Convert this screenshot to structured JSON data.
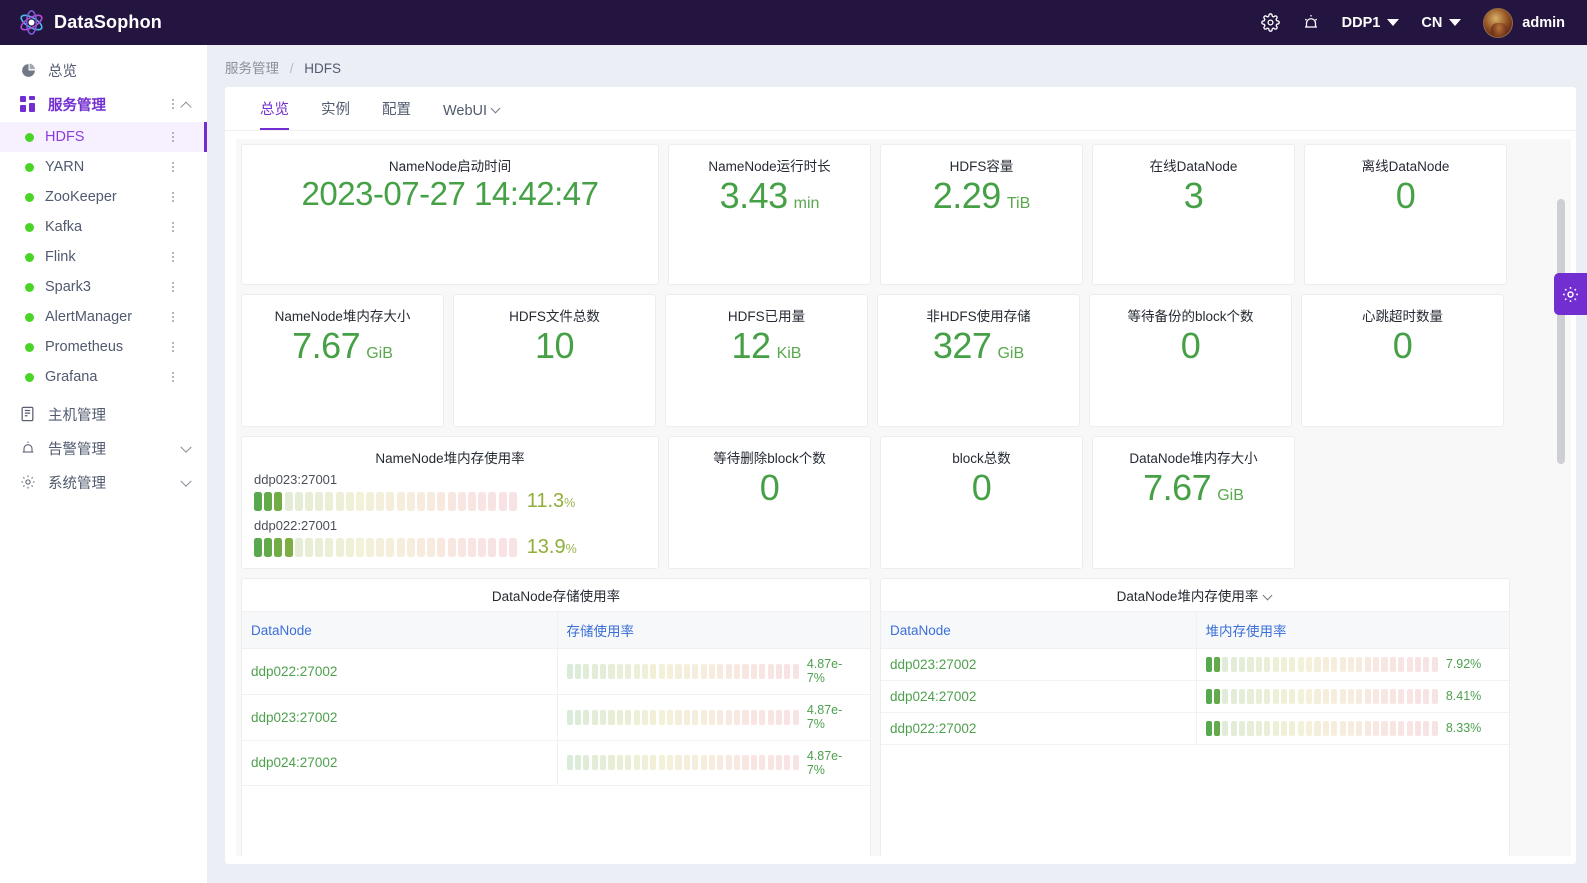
{
  "header": {
    "brand": "DataSophon",
    "logo_icon": "atom-icon",
    "settings_icon": "gear-icon",
    "alarm_icon": "alarm-bell-icon",
    "cluster": "DDP1",
    "language": "CN",
    "user": "admin",
    "avatar_icon": "user-avatar"
  },
  "sidebar": {
    "items": [
      {
        "label": "总览",
        "icon": "dashboard-icon",
        "type": "link"
      },
      {
        "label": "服务管理",
        "icon": "grid-apps-icon",
        "type": "group",
        "expanded": true,
        "active": true
      }
    ],
    "services": [
      {
        "label": "HDFS",
        "status": "running",
        "selected": true
      },
      {
        "label": "YARN",
        "status": "running",
        "selected": false
      },
      {
        "label": "ZooKeeper",
        "status": "running",
        "selected": false
      },
      {
        "label": "Kafka",
        "status": "running",
        "selected": false
      },
      {
        "label": "Flink",
        "status": "running",
        "selected": false
      },
      {
        "label": "Spark3",
        "status": "running",
        "selected": false
      },
      {
        "label": "AlertManager",
        "status": "running",
        "selected": false
      },
      {
        "label": "Prometheus",
        "status": "running",
        "selected": false
      },
      {
        "label": "Grafana",
        "status": "running",
        "selected": false
      }
    ],
    "bottom_items": [
      {
        "label": "主机管理",
        "icon": "server-icon",
        "collapsible": false
      },
      {
        "label": "告警管理",
        "icon": "alarm-bell-icon",
        "collapsible": true
      },
      {
        "label": "系统管理",
        "icon": "gear-icon",
        "collapsible": true
      }
    ]
  },
  "breadcrumb": {
    "parent": "服务管理",
    "separator": "/",
    "current": "HDFS"
  },
  "tabs": [
    {
      "label": "总览",
      "active": true,
      "has_chevron": false
    },
    {
      "label": "实例",
      "active": false,
      "has_chevron": false
    },
    {
      "label": "配置",
      "active": false,
      "has_chevron": false
    },
    {
      "label": "WebUI",
      "active": false,
      "has_chevron": true
    }
  ],
  "metrics_row1": [
    {
      "title": "NameNode启动时间",
      "value": "2023-07-27 14:42:47",
      "unit": "",
      "wide": true
    },
    {
      "title": "NameNode运行时长",
      "value": "3.43",
      "unit": "min"
    },
    {
      "title": "HDFS容量",
      "value": "2.29",
      "unit": "TiB"
    },
    {
      "title": "在线DataNode",
      "value": "3",
      "unit": ""
    },
    {
      "title": "离线DataNode",
      "value": "0",
      "unit": ""
    }
  ],
  "metrics_row2": [
    {
      "title": "NameNode堆内存大小",
      "value": "7.67",
      "unit": "GiB"
    },
    {
      "title": "HDFS文件总数",
      "value": "10",
      "unit": ""
    },
    {
      "title": "HDFS已用量",
      "value": "12",
      "unit": "KiB"
    },
    {
      "title": "非HDFS使用存储",
      "value": "327",
      "unit": "GiB"
    },
    {
      "title": "等待备份的block个数",
      "value": "0",
      "unit": ""
    },
    {
      "title": "心跳超时数量",
      "value": "0",
      "unit": ""
    }
  ],
  "namenode_heap_usage": {
    "title": "NameNode堆内存使用率",
    "rows": [
      {
        "label": "ddp023:27001",
        "value": "11.3",
        "suffix": "%",
        "pct": 11.3
      },
      {
        "label": "ddp022:27001",
        "value": "13.9",
        "suffix": "%",
        "pct": 13.9
      }
    ]
  },
  "metrics_row3": [
    {
      "title": "等待删除block个数",
      "value": "0",
      "unit": ""
    },
    {
      "title": "block总数",
      "value": "0",
      "unit": ""
    },
    {
      "title": "DataNode堆内存大小",
      "value": "7.67",
      "unit": "GiB"
    }
  ],
  "table_storage": {
    "title": "DataNode存储使用率",
    "has_chevron": false,
    "columns": [
      "DataNode",
      "存储使用率"
    ],
    "rows": [
      {
        "node": "ddp022:27002",
        "value": "4.87e-7%",
        "pct": 5e-07
      },
      {
        "node": "ddp023:27002",
        "value": "4.87e-7%",
        "pct": 5e-07
      },
      {
        "node": "ddp024:27002",
        "value": "4.87e-7%",
        "pct": 5e-07
      }
    ]
  },
  "table_heap": {
    "title": "DataNode堆内存使用率",
    "has_chevron": true,
    "columns": [
      "DataNode",
      "堆内存使用率"
    ],
    "rows": [
      {
        "node": "ddp023:27002",
        "value": "7.92%",
        "pct": 7.92
      },
      {
        "node": "ddp024:27002",
        "value": "8.41%",
        "pct": 8.41
      },
      {
        "node": "ddp022:27002",
        "value": "8.33%",
        "pct": 8.33
      }
    ]
  },
  "floating_settings": {
    "icon": "gear-icon"
  },
  "colors": {
    "brand_purple": "#722ed1",
    "topbar_bg": "#241440",
    "value_green": "#46a046",
    "status_green": "#4bd428",
    "link_blue": "#3a6fd8",
    "page_bg": "#eceef5"
  }
}
